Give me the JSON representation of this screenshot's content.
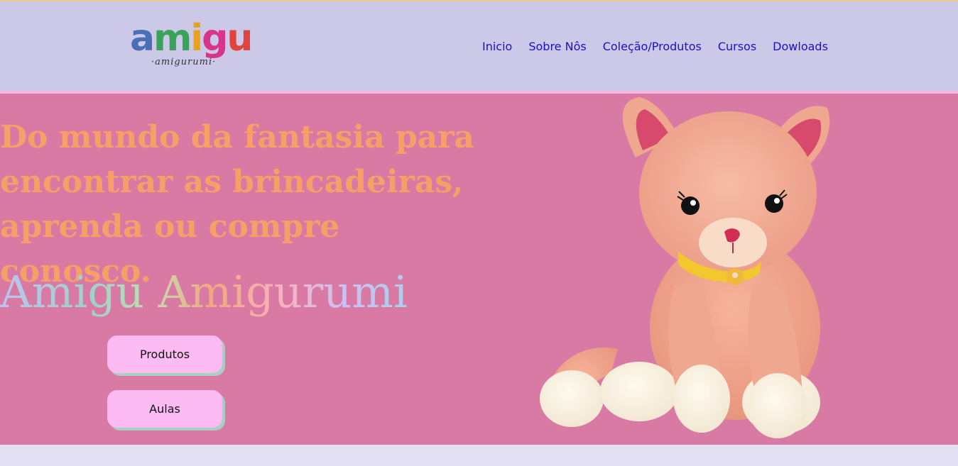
{
  "header": {
    "logo": {
      "letters": [
        {
          "char": "a",
          "color": "#4a6fb5"
        },
        {
          "char": "m",
          "color": "#3aa35a"
        },
        {
          "char": "i",
          "color": "#e8a21c"
        },
        {
          "char": "g",
          "color": "#d8348a"
        },
        {
          "char": "u",
          "color": "#e0443c"
        }
      ],
      "tagline": "·amigurumi·"
    },
    "nav": [
      "Inicio",
      "Sobre Nôs",
      "Coleção/Produtos",
      "Cursos",
      "Dowloads"
    ]
  },
  "hero": {
    "headline": "Do mundo da fantasia para encontrar as brincadeiras, aprenda ou compre conosco.",
    "brand": "Amigu Amigurumi",
    "buttons": {
      "produtos": "Produtos",
      "aulas": "Aulas"
    }
  },
  "colors": {
    "header_bg": "#cbc8e8",
    "hero_bg": "#d97aa5",
    "headline": "#f6a068",
    "nav_link": "#1a12c8",
    "button_bg": "#fcbcf3"
  }
}
